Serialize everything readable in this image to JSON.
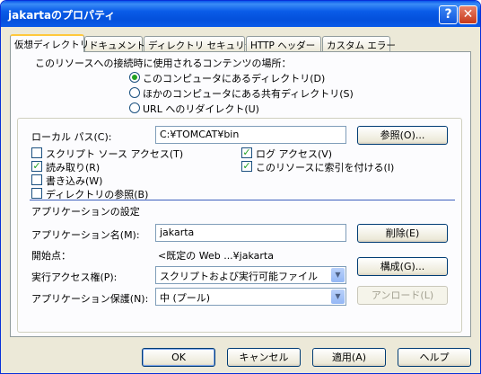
{
  "window": {
    "title": "jakartaのプロパティ",
    "help_glyph": "?",
    "close_glyph": "✕"
  },
  "tabs": [
    "仮想ディレクトリ",
    "ドキュメント",
    "ディレクトリ セキュリティ",
    "HTTP ヘッダー",
    "カスタム エラー"
  ],
  "source": {
    "heading": "このリソースへの接続時に使用されるコンテンツの場所：",
    "options": [
      "このコンピュータにあるディレクトリ(D)",
      "ほかのコンピュータにある共有ディレクトリ(S)",
      "URL へのリダイレクト(U)"
    ],
    "selected": 0
  },
  "local_path": {
    "label": "ローカル パス(C):",
    "value": "C:¥TOMCAT¥bin",
    "browse_label": "参照(O)..."
  },
  "checkboxes": {
    "script_source": {
      "label": "スクリプト ソース アクセス(T)",
      "checked": false
    },
    "read": {
      "label": "読み取り(R)",
      "checked": true
    },
    "write": {
      "label": "書き込み(W)",
      "checked": false
    },
    "dir_browse": {
      "label": "ディレクトリの参照(B)",
      "checked": false
    },
    "log_access": {
      "label": "ログ アクセス(V)",
      "checked": true
    },
    "index": {
      "label": "このリソースに索引を付ける(I)",
      "checked": true
    }
  },
  "app": {
    "section_title": "アプリケーションの設定",
    "name_label": "アプリケーション名(M):",
    "name_value": "jakarta",
    "remove_label": "削除(E)",
    "start_label": "開始点：",
    "start_value": "<既定の Web ...¥jakarta",
    "config_label": "構成(G)...",
    "exec_label": "実行アクセス権(P):",
    "exec_value": "スクリプトおよび実行可能ファイル",
    "protect_label": "アプリケーション保護(N):",
    "protect_value": "中 (プール)",
    "unload_label": "アンロード(L)"
  },
  "footer": {
    "ok": "OK",
    "cancel": "キャンセル",
    "apply": "適用(A)",
    "help": "ヘルプ"
  },
  "colors": {
    "title_bar": "#0a5ce8",
    "dialog_bg": "#ece9d8",
    "check_green": "#21a121"
  }
}
